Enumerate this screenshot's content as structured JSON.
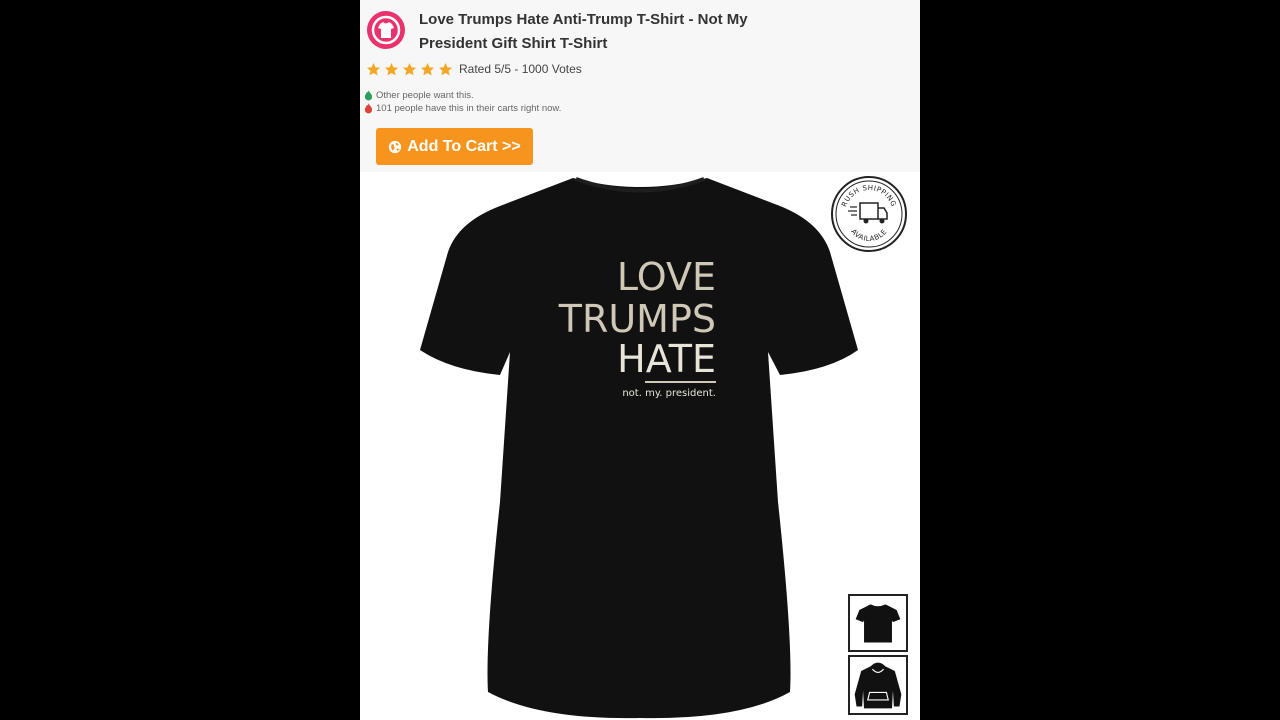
{
  "product": {
    "title": "Love Trumps Hate Anti-Trump T-Shirt - Not My President Gift Shirt T-Shirt",
    "rating_text": "Rated 5/5 - 1000 Votes",
    "stars": 5
  },
  "notices": {
    "other_people": "Other people want this.",
    "carts": "101 people have this in their carts right now."
  },
  "cart": {
    "button_label": "Add To Cart >>"
  },
  "shirt_print": {
    "line1": "LOVE",
    "line2": "TRUMPS",
    "line3": "HATE",
    "tagline": "not. my. president."
  },
  "badge": {
    "top_text": "RUSH SHIPPING",
    "bottom_text": "AVAILABLE"
  },
  "colors": {
    "accent_button": "#f7941d",
    "star": "#f5a623",
    "logo": "#e8336d",
    "shirt": "#111111",
    "print": "#cfc8b6"
  },
  "icons": [
    "store-logo-icon",
    "star-icon",
    "flame-icon",
    "globe-icon",
    "rush-shipping-badge-icon",
    "tshirt-icon",
    "hoodie-icon"
  ]
}
